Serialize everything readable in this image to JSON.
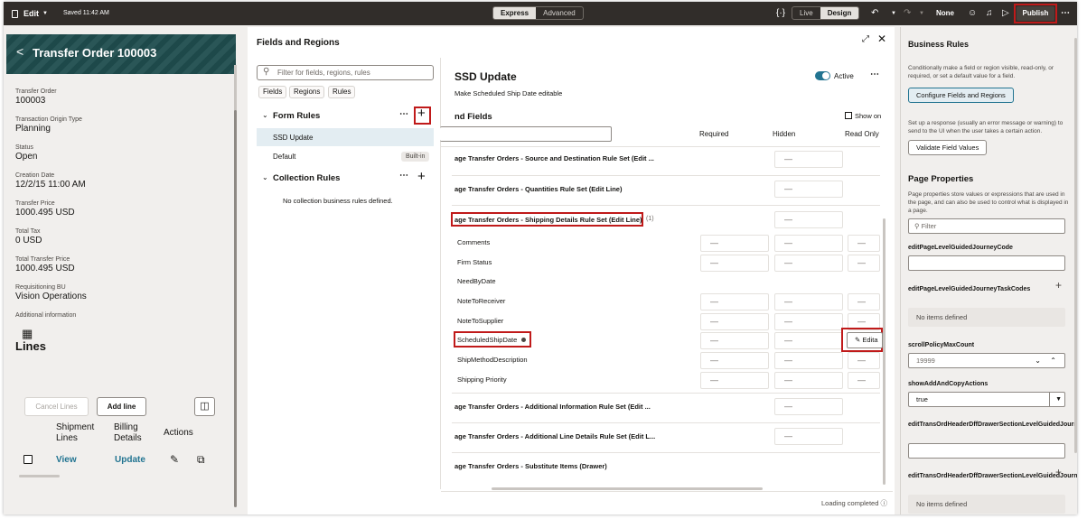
{
  "topbar": {
    "edit": "Edit",
    "saved": "Saved 11:42 AM",
    "mode_express": "Express",
    "mode_advanced": "Advanced",
    "view_live": "Live",
    "view_design": "Design",
    "none": "None",
    "publish": "Publish"
  },
  "left": {
    "title": "Transfer Order 100003",
    "details": [
      {
        "label": "Transfer Order",
        "value": "100003"
      },
      {
        "label": "Transaction Origin Type",
        "value": "Planning"
      },
      {
        "label": "Status",
        "value": "Open"
      },
      {
        "label": "Creation Date",
        "value": "12/2/15 11:00 AM"
      },
      {
        "label": "Transfer Price",
        "value": "1000.495 USD"
      },
      {
        "label": "Total Tax",
        "value": "0 USD"
      },
      {
        "label": "Total Transfer Price",
        "value": "1000.495 USD"
      },
      {
        "label": "Requisitioning BU",
        "value": "Vision Operations"
      }
    ],
    "additional": "Additional information",
    "lines_title": "Lines",
    "cancel_lines": "Cancel Lines",
    "add_line": "Add line",
    "col_shipment": "Shipment Lines",
    "col_billing": "Billing Details",
    "col_actions": "Actions",
    "link_view": "View",
    "link_update": "Update"
  },
  "mid": {
    "header": "Fields and Regions",
    "filter_placeholder": "Filter for fields, regions, rules",
    "chips": [
      "Fields",
      "Regions",
      "Rules"
    ],
    "form_rules": "Form Rules",
    "rules": [
      {
        "name": "SSD Update"
      },
      {
        "name": "Default",
        "badge": "Built-in"
      }
    ],
    "collection_rules": "Collection Rules",
    "no_collection": "No collection business rules defined.",
    "rule_title": "SSD Update",
    "rule_desc": "Make Scheduled Ship Date editable",
    "active": "Active",
    "fields_title": "nd Fields",
    "show_on": "Show on",
    "col_required": "Required",
    "col_hidden": "Hidden",
    "col_readonly": "Read Only",
    "rulesets": [
      "age Transfer Orders - Source and Destination Rule Set (Edit ...",
      "age Transfer Orders - Quantities Rule Set (Edit Line)",
      "age Transfer Orders - Shipping Details Rule Set (Edit Line)",
      "age Transfer Orders - Additional Information Rule Set (Edit ...",
      "age Transfer Orders - Additional Line Details Rule Set (Edit L...",
      "age Transfer Orders - Substitute Items (Drawer)"
    ],
    "ruleset_count": "(1)",
    "fields": [
      "Comments",
      "Firm Status",
      "NeedByDate",
      "NoteToReceiver",
      "NoteToSupplier",
      "ScheduledShipDate",
      "ShipMethodDescription",
      "Shipping Priority"
    ],
    "dash": "—",
    "editable": "Edita",
    "loading": "Loading completed"
  },
  "right": {
    "title": "Business Rules",
    "desc": "Conditionally make a field or region visible, read-only, or required, or set a default value for a field.",
    "configure": "Configure Fields and Regions",
    "desc2": "Set up a response (usually an error message or warning) to send to the UI when the user takes a certain action.",
    "validate": "Validate Field Values",
    "page_props": "Page Properties",
    "page_props_desc": "Page properties store values or expressions that are used in the page, and can also be used to control what is displayed in a page.",
    "filter": "Filter",
    "p1": "editPageLevelGuidedJourneyCode",
    "p2": "editPageLevelGuidedJourneyTaskCodes",
    "no_items": "No items defined",
    "p3": "scrollPolicyMaxCount",
    "p3_val": "19999",
    "p4": "showAddAndCopyActions",
    "p4_val": "true",
    "p5": "editTransOrdHeaderDffDrawerSectionLevelGuidedJourneyCode",
    "p6": "editTransOrdHeaderDffDrawerSectionLevelGuidedJourneyTaskCodes",
    "no_items2": "No items defined"
  }
}
